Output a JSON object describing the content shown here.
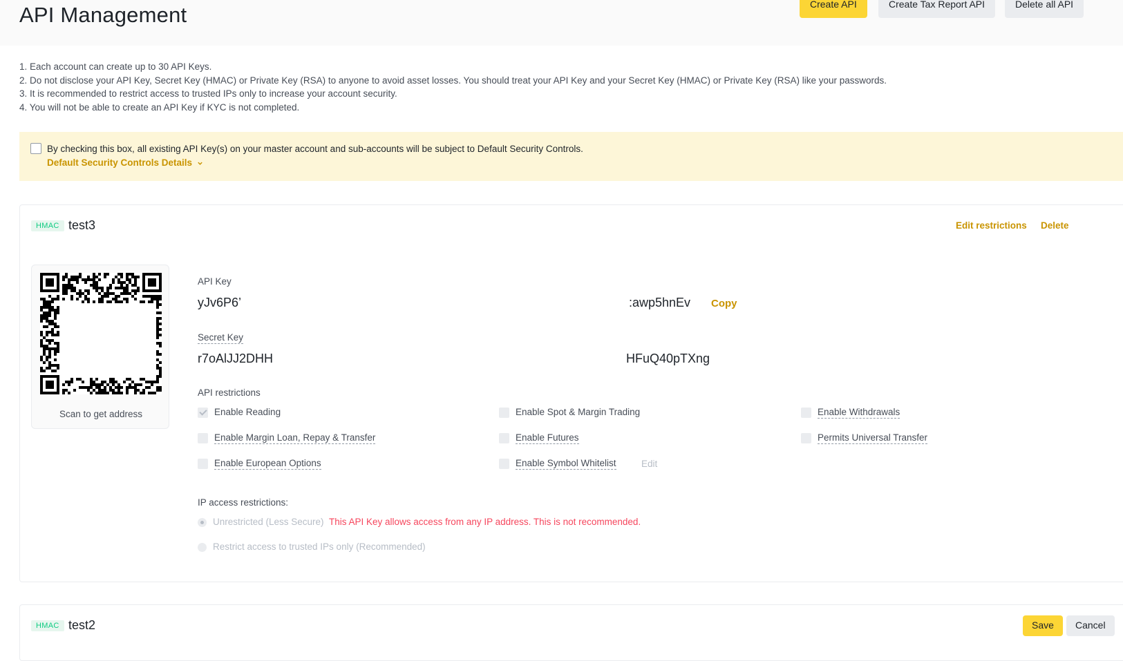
{
  "header": {
    "title": "API Management",
    "buttons": {
      "create_api": "Create API",
      "create_tax_report_api": "Create Tax Report API",
      "delete_all_api": "Delete all API"
    }
  },
  "notes": [
    "1. Each account can create up to 30 API Keys.",
    "2. Do not disclose your API Key, Secret Key (HMAC) or Private Key (RSA) to anyone to avoid asset losses. You should treat your API Key and your Secret Key (HMAC) or Private Key (RSA) like your passwords.",
    "3. It is recommended to restrict access to trusted IPs only to increase your account security.",
    "4. You will not be able to create an API Key if KYC is not completed."
  ],
  "security_banner": {
    "checked": false,
    "text": "By checking this box, all existing API Key(s) on your master account and sub-accounts will be subject to Default Security Controls.",
    "details_link": "Default Security Controls Details",
    "details_icon": "chevron-down-icon"
  },
  "api_keys": [
    {
      "badge": "HMAC",
      "name": "test3",
      "actions": {
        "edit": "Edit restrictions",
        "delete": "Delete"
      },
      "qr_caption": "Scan to get address",
      "api_key_label": "API Key",
      "api_key_start": "yJv6P6’",
      "api_key_end": ":awp5hnEv",
      "copy_label": "Copy",
      "secret_key_label": "Secret Key",
      "secret_key_start": "r7oAlJJ2DHH",
      "secret_key_end": "HFuQ40pTXng",
      "restrictions_label": "API restrictions",
      "permissions": [
        {
          "label": "Enable Reading",
          "checked": true
        },
        {
          "label": "Enable Spot & Margin Trading",
          "checked": false
        },
        {
          "label": "Enable Withdrawals",
          "checked": false
        },
        {
          "label": "Enable Margin Loan, Repay & Transfer",
          "checked": false
        },
        {
          "label": "Enable Futures",
          "checked": false
        },
        {
          "label": "Permits Universal Transfer",
          "checked": false
        },
        {
          "label": "Enable European Options",
          "checked": false
        },
        {
          "label": "Enable Symbol Whitelist",
          "checked": false
        }
      ],
      "whitelist_edit": "Edit",
      "ip_label": "IP access restrictions:",
      "ip_options": [
        {
          "label": "Unrestricted (Less Secure)",
          "selected": true
        },
        {
          "label": "Restrict access to trusted IPs only (Recommended)",
          "selected": false
        }
      ],
      "ip_warning": "This API Key allows access from any IP address. This is not recommended."
    },
    {
      "badge": "HMAC",
      "name": "test2",
      "actions": {
        "save": "Save",
        "cancel": "Cancel"
      }
    }
  ],
  "colors": {
    "accent": "#fcd535",
    "link": "#c99400",
    "warning": "#f6465d",
    "badge_text": "#0ecb81",
    "banner_bg": "#fdf6d8"
  }
}
